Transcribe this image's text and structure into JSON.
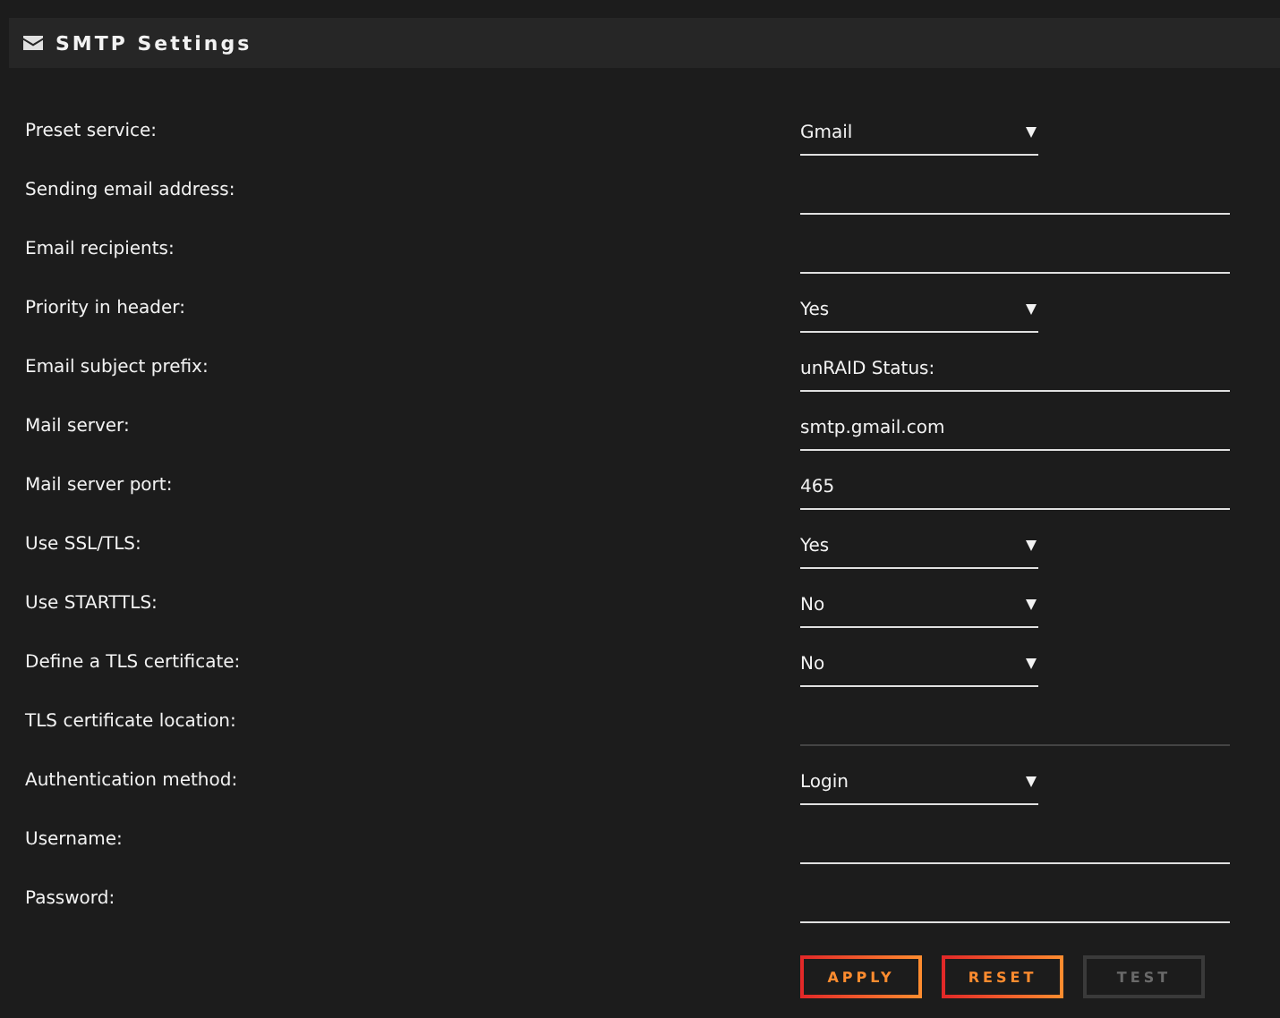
{
  "header": {
    "title": "SMTP Settings"
  },
  "fields": [
    {
      "label": "Preset service:",
      "kind": "select",
      "value": "Gmail",
      "disabled": false
    },
    {
      "label": "Sending email address:",
      "kind": "input",
      "disabled": false
    },
    {
      "label": "Email recipients:",
      "kind": "input",
      "disabled": false
    },
    {
      "label": "Priority in header:",
      "kind": "select",
      "value": "Yes",
      "disabled": false
    },
    {
      "label": "Email subject prefix:",
      "kind": "input",
      "value": "unRAID Status:",
      "disabled": false
    },
    {
      "label": "Mail server:",
      "kind": "input",
      "value": "smtp.gmail.com",
      "disabled": false
    },
    {
      "label": "Mail server port:",
      "kind": "input",
      "value": "465",
      "disabled": false
    },
    {
      "label": "Use SSL/TLS:",
      "kind": "select",
      "value": "Yes",
      "disabled": false
    },
    {
      "label": "Use STARTTLS:",
      "kind": "select",
      "value": "No",
      "disabled": false
    },
    {
      "label": "Define a TLS certificate:",
      "kind": "select",
      "value": "No",
      "disabled": false
    },
    {
      "label": "TLS certificate location:",
      "kind": "input",
      "disabled": true
    },
    {
      "label": "Authentication method:",
      "kind": "select",
      "value": "Login",
      "disabled": false
    },
    {
      "label": "Username:",
      "kind": "input",
      "disabled": false
    },
    {
      "label": "Password:",
      "kind": "password",
      "disabled": false
    }
  ],
  "buttons": [
    {
      "label": "APPLY",
      "disabled": false
    },
    {
      "label": "RESET",
      "disabled": false
    },
    {
      "label": "TEST",
      "disabled": true
    }
  ]
}
